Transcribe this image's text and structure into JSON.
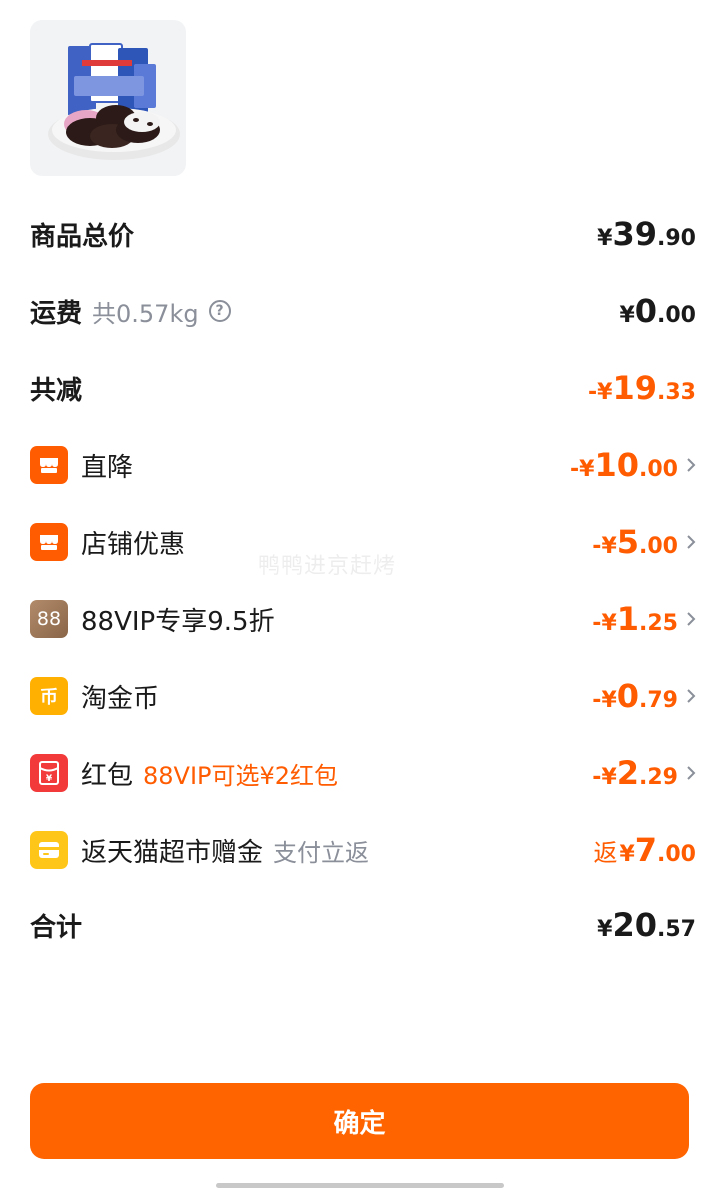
{
  "summary": {
    "total_label": "商品总价",
    "total": {
      "cur": "¥",
      "int": "39",
      "dec": ".90"
    },
    "shipping_label": "运费",
    "shipping_weight": "共0.57kg",
    "shipping": {
      "cur": "¥",
      "int": "0",
      "dec": ".00"
    },
    "discount_label": "共减",
    "discount": {
      "prefix": "-",
      "cur": "¥",
      "int": "19",
      "dec": ".33"
    }
  },
  "discounts": [
    {
      "icon": "storefront-icon",
      "badge_text": "",
      "label": "直降",
      "sub": "",
      "prefix": "-",
      "cur": "¥",
      "int": "10",
      "dec": ".00"
    },
    {
      "icon": "storefront-icon",
      "badge_text": "",
      "label": "店铺优惠",
      "sub": "",
      "prefix": "-",
      "cur": "¥",
      "int": "5",
      "dec": ".00"
    },
    {
      "icon": "vip88-icon",
      "badge_text": "88",
      "label": "88VIP专享9.5折",
      "sub": "",
      "prefix": "-",
      "cur": "¥",
      "int": "1",
      "dec": ".25"
    },
    {
      "icon": "coin-icon",
      "badge_text": "币",
      "label": "淘金币",
      "sub": "",
      "prefix": "-",
      "cur": "¥",
      "int": "0",
      "dec": ".79"
    },
    {
      "icon": "red-packet-icon",
      "badge_text": "¥",
      "label": "红包",
      "sub": "88VIP可选¥2红包",
      "prefix": "-",
      "cur": "¥",
      "int": "2",
      "dec": ".29"
    }
  ],
  "rebate": {
    "icon": "card-icon",
    "label": "返天猫超市赠金",
    "sub": "支付立返",
    "prefix": "返",
    "cur": "¥",
    "int": "7",
    "dec": ".00"
  },
  "grand_total": {
    "label": "合计",
    "cur": "¥",
    "int": "20",
    "dec": ".57"
  },
  "watermark": "鸭鸭进京赶烤",
  "confirm_label": "确定",
  "colors": {
    "accent": "#ff5b00",
    "button": "#ff6400",
    "muted": "#8a8f99"
  }
}
